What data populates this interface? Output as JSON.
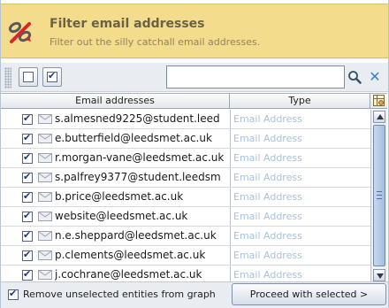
{
  "header": {
    "title": "Filter email addresses",
    "description": "Filter out the silly catchall email addresses."
  },
  "toolbar": {
    "select_none_icon": "empty-checkbox-icon",
    "select_all_icon": "checked-checkbox-icon",
    "search_value": "",
    "search_icon": "magnifier-icon",
    "clear_icon": "close-x-icon"
  },
  "table": {
    "columns": [
      "Email addresses",
      "Type"
    ],
    "rows": [
      {
        "email": "s.almesned9225@student.leed",
        "type": "Email Address",
        "checked": true
      },
      {
        "email": "e.butterfield@leedsmet.ac.uk",
        "type": "Email Address",
        "checked": true
      },
      {
        "email": "r.morgan-vane@leedsmet.ac.uk",
        "type": "Email Address",
        "checked": true
      },
      {
        "email": "s.palfrey9377@student.leedsm",
        "type": "Email Address",
        "checked": true
      },
      {
        "email": "b.price@leedsmet.ac.uk",
        "type": "Email Address",
        "checked": true
      },
      {
        "email": "website@leedsmet.ac.uk",
        "type": "Email Address",
        "checked": true
      },
      {
        "email": "n.e.sheppard@leedsmet.ac.uk",
        "type": "Email Address",
        "checked": true
      },
      {
        "email": "p.clements@leedsmet.ac.uk",
        "type": "Email Address",
        "checked": true
      },
      {
        "email": "j.cochrane@leedsmet.ac.uk",
        "type": "Email Address",
        "checked": true
      }
    ]
  },
  "footer": {
    "remove_unselected_label": "Remove unselected entities from graph",
    "remove_unselected_checked": true,
    "proceed_label": "Proceed with selected >"
  },
  "colors": {
    "header_bg": "#f3dc8c",
    "type_text": "#a9c2dc"
  }
}
